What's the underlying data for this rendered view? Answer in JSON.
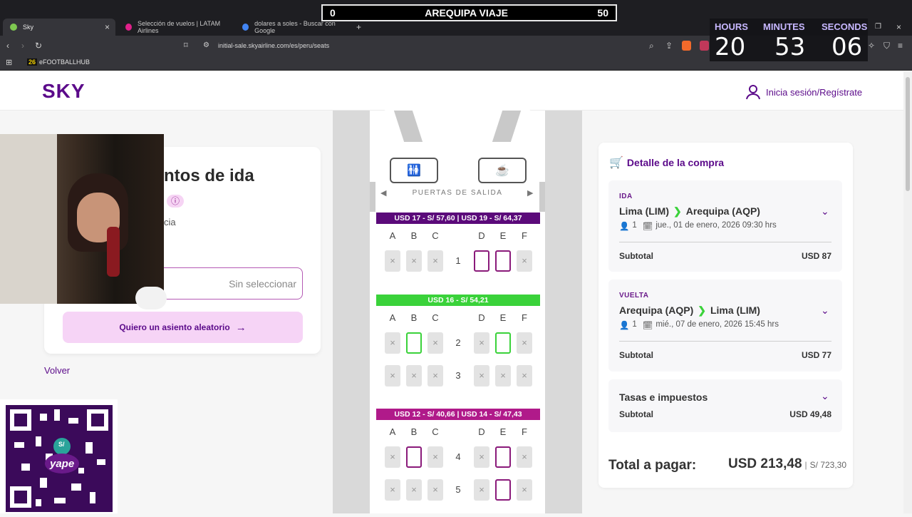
{
  "browser": {
    "tabs": [
      {
        "label": "Sky",
        "color": "#7ec850"
      },
      {
        "label": "Selección de vuelos | LATAM Airlines",
        "color": "#e0208a"
      },
      {
        "label": "dolares a soles - Buscar con Google",
        "color": "#4285f4"
      }
    ],
    "url": "initial-sale.skyairline.com/es/peru/seats",
    "bookmark": "eFOOTBALLHUB",
    "bookmark_badge": "26"
  },
  "overlay": {
    "banner_left": "0",
    "banner_title": "AREQUIPA VIAJE",
    "banner_right": "50",
    "countdown": {
      "hours_label": "HOURS",
      "minutes_label": "MINUTES",
      "seconds_label": "SECONDS",
      "hours": "20",
      "minutes": "53",
      "seconds": "06"
    },
    "qr_brand": "yape",
    "qr_currency": "S/"
  },
  "header": {
    "logo": "SKY",
    "login": "Inicia sesión/Regístrate"
  },
  "left": {
    "title": "ntos de ida",
    "subtext": "cia",
    "seat_placeholder": "Sin seleccionar",
    "random_button": "Quiero un asiento aleatorio",
    "back": "Volver"
  },
  "seatmap": {
    "exits": "PUERTAS DE SALIDA",
    "columns": [
      "A",
      "B",
      "C",
      "D",
      "E",
      "F"
    ],
    "bands": [
      {
        "text": "USD 17 - S/ 57,60 | USD 19 - S/ 64,37",
        "color": "#5b0a7a"
      },
      {
        "text": "USD 16 - S/ 54,21",
        "color": "#3ad23a"
      },
      {
        "text": "USD 12 - S/ 40,66 | USD 14 - S/ 47,43",
        "color": "#b01a8a"
      }
    ],
    "rows": [
      {
        "num": "1",
        "seats": [
          "taken",
          "taken",
          "taken",
          "purple",
          "purple",
          "taken"
        ]
      },
      {
        "num": "2",
        "seats": [
          "taken",
          "green",
          "taken",
          "taken",
          "green",
          "taken"
        ]
      },
      {
        "num": "3",
        "seats": [
          "taken",
          "taken",
          "taken",
          "taken",
          "taken",
          "taken"
        ]
      },
      {
        "num": "4",
        "seats": [
          "taken",
          "purple",
          "taken",
          "taken",
          "purple",
          "taken"
        ]
      },
      {
        "num": "5",
        "seats": [
          "taken",
          "taken",
          "taken",
          "taken",
          "purple",
          "taken"
        ]
      }
    ]
  },
  "detail": {
    "title": "Detalle de la compra",
    "ida": {
      "label": "IDA",
      "from": "Lima (LIM)",
      "to": "Arequipa (AQP)",
      "pax": "1",
      "date": "jue., 01 de enero, 2026 09:30 hrs",
      "subtotal_label": "Subtotal",
      "subtotal": "USD 87"
    },
    "vuelta": {
      "label": "VUELTA",
      "from": "Arequipa (AQP)",
      "to": "Lima (LIM)",
      "pax": "1",
      "date": "mié., 07 de enero, 2026 15:45 hrs",
      "subtotal_label": "Subtotal",
      "subtotal": "USD 77"
    },
    "tasas": {
      "label": "Tasas e impuestos",
      "subtotal_label": "Subtotal",
      "subtotal": "USD 49,48"
    },
    "total_label": "Total a pagar:",
    "total_usd": "USD 213,48",
    "total_pen": "S/ 723,30"
  }
}
